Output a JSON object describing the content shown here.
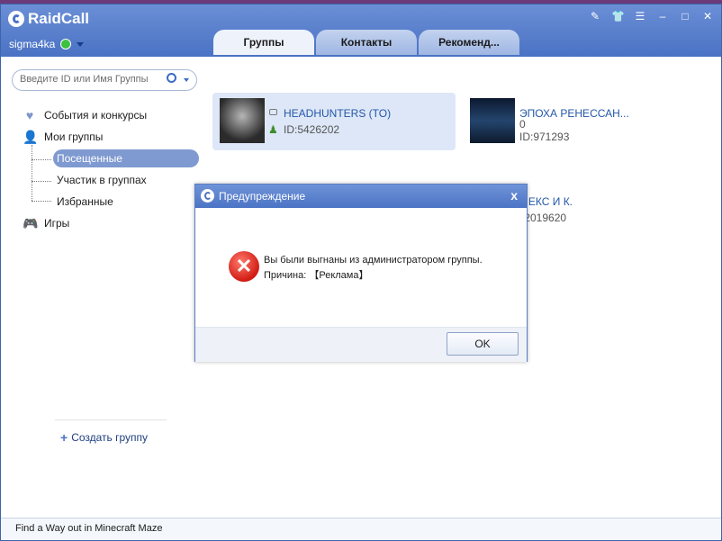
{
  "app": {
    "title": "RaidCall",
    "username": "sigma4ka"
  },
  "tabs": [
    {
      "label": "Группы",
      "active": true
    },
    {
      "label": "Контакты",
      "active": false
    },
    {
      "label": "Рекоменд...",
      "active": false
    }
  ],
  "search": {
    "placeholder": "Введите ID или Имя Группы"
  },
  "nav": {
    "events": "События и конкурсы",
    "my_groups": "Мои группы",
    "visited": "Посещенные",
    "member": "Участик в группах",
    "favorites": "Избранные",
    "games": "Игры"
  },
  "create_group": "Создать группу",
  "groups": [
    {
      "name": "HEADHUNTERS (TO)",
      "id": "ID:5426202",
      "selected": true
    },
    {
      "name": "ЭПОХА РЕНЕССАН...",
      "count": "0",
      "id": "ID:971293",
      "selected": false
    },
    {
      "name": "ЛЕКС И К.",
      "id": ":2019620",
      "selected": false
    }
  ],
  "status_bar": "Find a Way out in Minecraft Maze",
  "dialog": {
    "title": "Предупреждение",
    "line1": "Вы были выгнаны из администратором группы.",
    "line2": "Причина: 【Реклама】",
    "ok": "OK",
    "close": "x"
  },
  "colors": {
    "titlebar": "#5b80cd",
    "accent": "#7f9ad0",
    "error": "#d11c13"
  }
}
